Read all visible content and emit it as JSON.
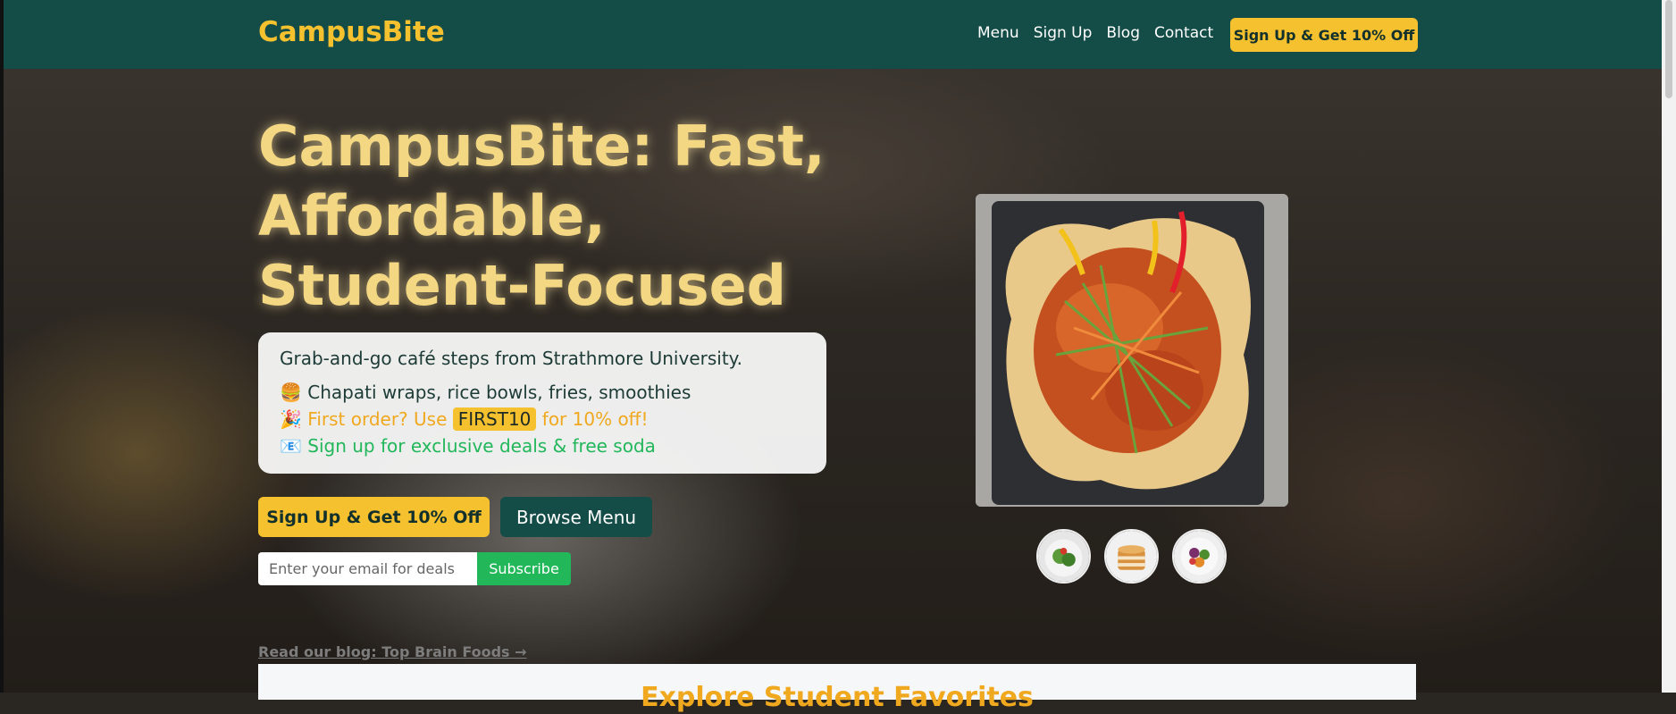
{
  "nav": {
    "logo": "CampusBite",
    "links": [
      "Menu",
      "Sign Up",
      "Blog",
      "Contact"
    ],
    "cta": "Sign Up & Get 10% Off"
  },
  "hero": {
    "title": "CampusBite: Fast, Affordable, Student-Focused",
    "tagline": "Grab-and-go café steps from Strathmore University.",
    "line_menu": {
      "emoji": "🍔",
      "text": "Chapati wraps, rice bowls, fries, smoothies"
    },
    "line_promo": {
      "emoji": "🎉",
      "before": "First order? Use",
      "code": "FIRST10",
      "after": "for 10% off!"
    },
    "line_signup": {
      "emoji": "📧",
      "text": "Sign up for exclusive deals & free soda"
    },
    "primary_button": "Sign Up & Get 10% Off",
    "secondary_button": "Browse Menu",
    "email_placeholder": "Enter your email for deals",
    "subscribe_button": "Subscribe",
    "blog_link": "Read our blog: Top Brain Foods →"
  },
  "colors": {
    "navbar": "#144d47",
    "accent": "#f6c12e",
    "green": "#22b85a",
    "orange": "#f0a81e"
  },
  "bottom": {
    "title": "Explore Student Favorites"
  }
}
